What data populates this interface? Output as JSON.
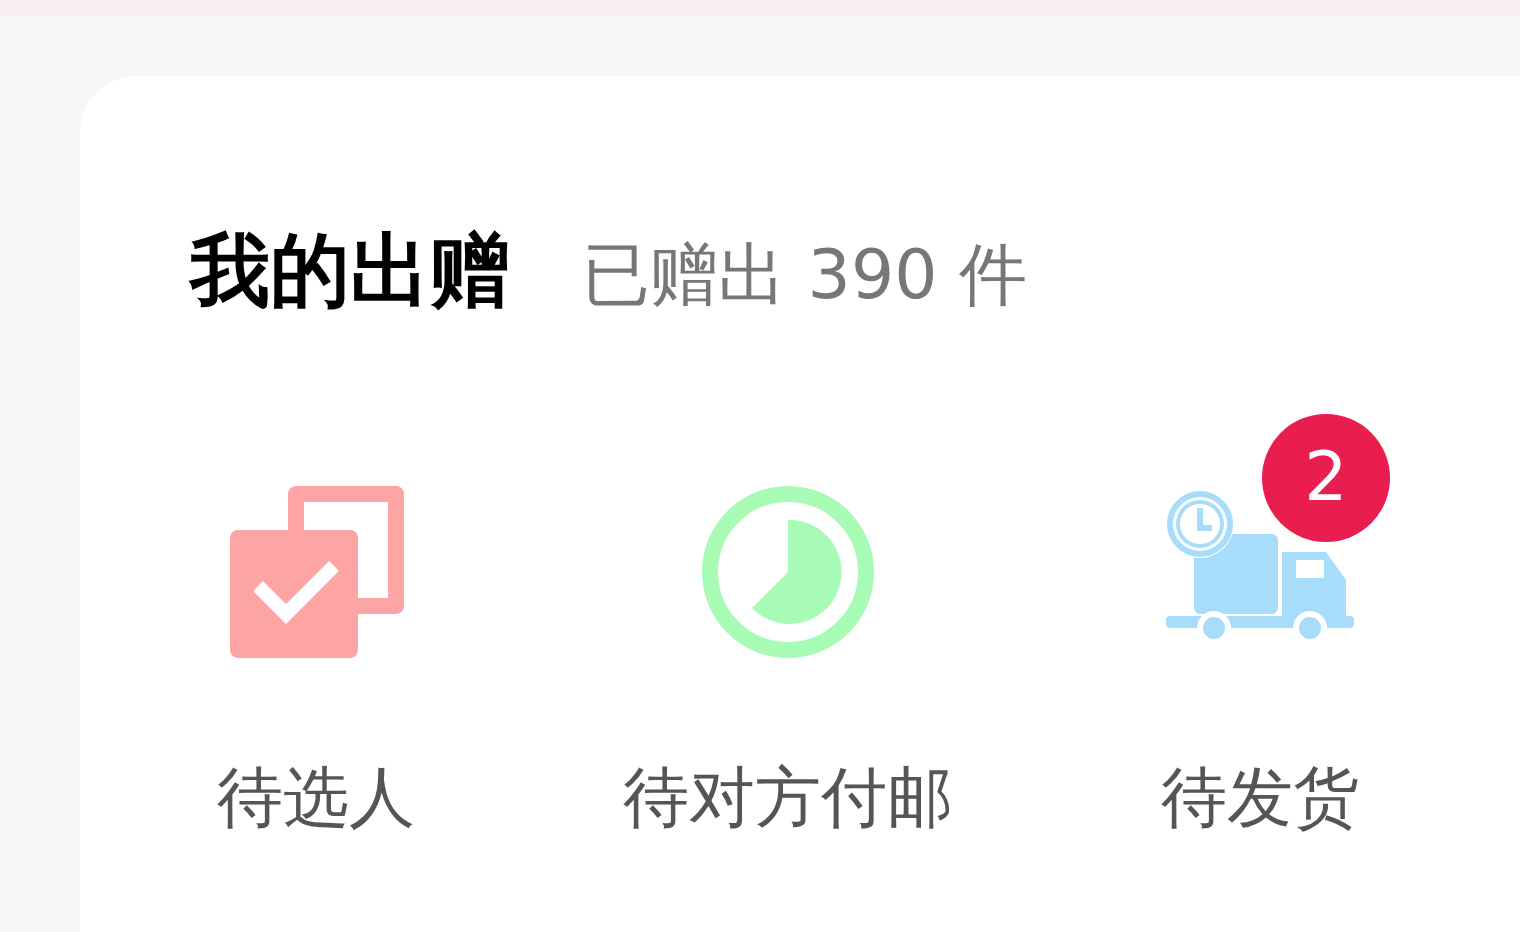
{
  "section": {
    "title": "我的出赠",
    "summary": "已赠出 390 件"
  },
  "items": [
    {
      "kind": "select",
      "label": "待选人"
    },
    {
      "kind": "awaiting-payment",
      "label": "待对方付邮"
    },
    {
      "kind": "shipping",
      "label": "待发货",
      "badge": "2"
    }
  ]
}
